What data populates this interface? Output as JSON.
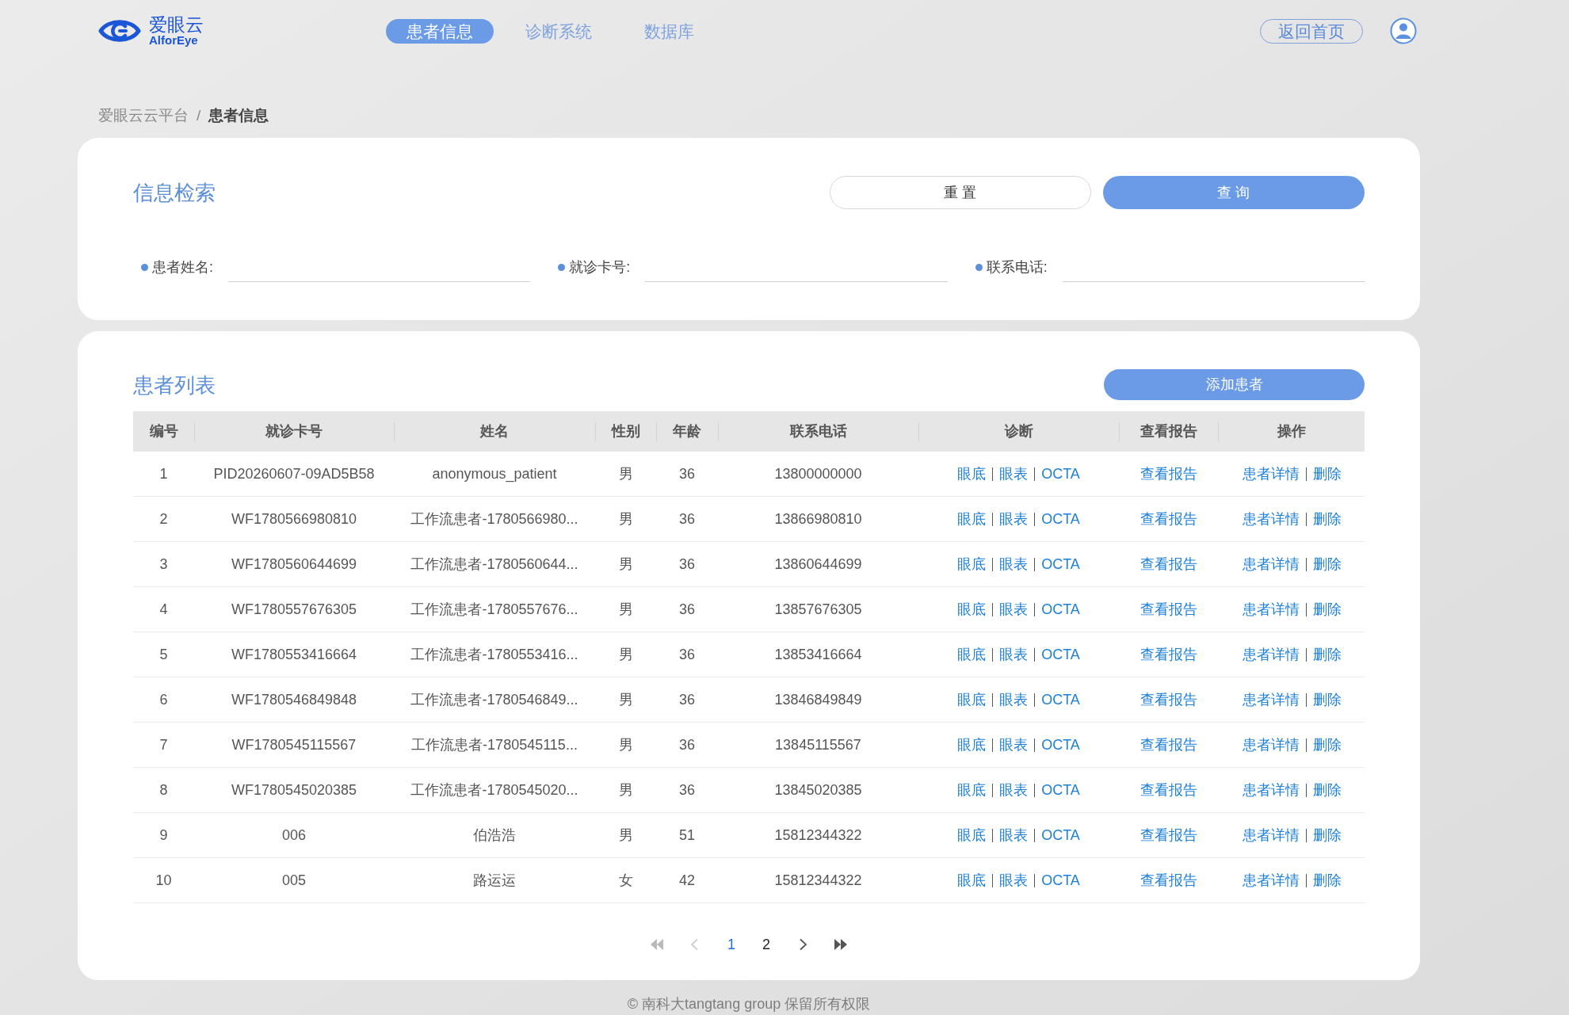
{
  "header": {
    "logo": {
      "title": "爱眼云",
      "subtitle": "AlforEye"
    },
    "nav": [
      {
        "label": "患者信息",
        "selected": true
      },
      {
        "label": "诊断系统",
        "selected": false
      },
      {
        "label": "数据库",
        "selected": false
      }
    ],
    "home_button": "返回首页"
  },
  "breadcrumb": {
    "separator": "/",
    "items": [
      {
        "label": "爱眼云云平台",
        "current": false
      },
      {
        "label": "患者信息",
        "current": true
      }
    ]
  },
  "search": {
    "title": "信息检索",
    "buttons": [
      {
        "label": "重 置",
        "kind": "secondary"
      },
      {
        "label": "查 询",
        "kind": "primary"
      }
    ],
    "fields": [
      {
        "label": "患者姓名:"
      },
      {
        "label": "就诊卡号:"
      },
      {
        "label": "联系电话:"
      }
    ]
  },
  "patients": {
    "title": "患者列表",
    "add_button": "添加患者",
    "columns": [
      "编号",
      "就诊卡号",
      "姓名",
      "性别",
      "年龄",
      "联系电话",
      "诊断",
      "查看报告",
      "操作"
    ],
    "rows": [
      {
        "cells": [
          "1",
          "PID20260607-09AD5B58",
          "anonymous_patient",
          "男",
          "36",
          "13800000000"
        ],
        "diagnosis": [
          "眼底",
          "眼表",
          "OCTA"
        ],
        "report": "查看报告",
        "actions": [
          "患者详情",
          "删除"
        ]
      },
      {
        "cells": [
          "2",
          "WF1780566980810",
          "工作流患者-1780566980...",
          "男",
          "36",
          "13866980810"
        ],
        "diagnosis": [
          "眼底",
          "眼表",
          "OCTA"
        ],
        "report": "查看报告",
        "actions": [
          "患者详情",
          "删除"
        ]
      },
      {
        "cells": [
          "3",
          "WF1780560644699",
          "工作流患者-1780560644...",
          "男",
          "36",
          "13860644699"
        ],
        "diagnosis": [
          "眼底",
          "眼表",
          "OCTA"
        ],
        "report": "查看报告",
        "actions": [
          "患者详情",
          "删除"
        ]
      },
      {
        "cells": [
          "4",
          "WF1780557676305",
          "工作流患者-1780557676...",
          "男",
          "36",
          "13857676305"
        ],
        "diagnosis": [
          "眼底",
          "眼表",
          "OCTA"
        ],
        "report": "查看报告",
        "actions": [
          "患者详情",
          "删除"
        ]
      },
      {
        "cells": [
          "5",
          "WF1780553416664",
          "工作流患者-1780553416...",
          "男",
          "36",
          "13853416664"
        ],
        "diagnosis": [
          "眼底",
          "眼表",
          "OCTA"
        ],
        "report": "查看报告",
        "actions": [
          "患者详情",
          "删除"
        ]
      },
      {
        "cells": [
          "6",
          "WF1780546849848",
          "工作流患者-1780546849...",
          "男",
          "36",
          "13846849849"
        ],
        "diagnosis": [
          "眼底",
          "眼表",
          "OCTA"
        ],
        "report": "查看报告",
        "actions": [
          "患者详情",
          "删除"
        ]
      },
      {
        "cells": [
          "7",
          "WF1780545115567",
          "工作流患者-1780545115...",
          "男",
          "36",
          "13845115567"
        ],
        "diagnosis": [
          "眼底",
          "眼表",
          "OCTA"
        ],
        "report": "查看报告",
        "actions": [
          "患者详情",
          "删除"
        ]
      },
      {
        "cells": [
          "8",
          "WF1780545020385",
          "工作流患者-1780545020...",
          "男",
          "36",
          "13845020385"
        ],
        "diagnosis": [
          "眼底",
          "眼表",
          "OCTA"
        ],
        "report": "查看报告",
        "actions": [
          "患者详情",
          "删除"
        ]
      },
      {
        "cells": [
          "9",
          "006",
          "伯浩浩",
          "男",
          "51",
          "15812344322"
        ],
        "diagnosis": [
          "眼底",
          "眼表",
          "OCTA"
        ],
        "report": "查看报告",
        "actions": [
          "患者详情",
          "删除"
        ]
      },
      {
        "cells": [
          "10",
          "005",
          "路运运",
          "女",
          "42",
          "15812344322"
        ],
        "diagnosis": [
          "眼底",
          "眼表",
          "OCTA"
        ],
        "report": "查看报告",
        "actions": [
          "患者详情",
          "删除"
        ]
      }
    ]
  },
  "pagination": {
    "items": [
      {
        "kind": "first",
        "disabled": true
      },
      {
        "kind": "prev",
        "disabled": true
      },
      {
        "kind": "page",
        "label": "1",
        "selected": true
      },
      {
        "kind": "page",
        "label": "2",
        "selected": false
      },
      {
        "kind": "next",
        "disabled": false
      },
      {
        "kind": "last",
        "disabled": false
      }
    ]
  },
  "footer": "© 南科大tangtang group 保留所有权限"
}
